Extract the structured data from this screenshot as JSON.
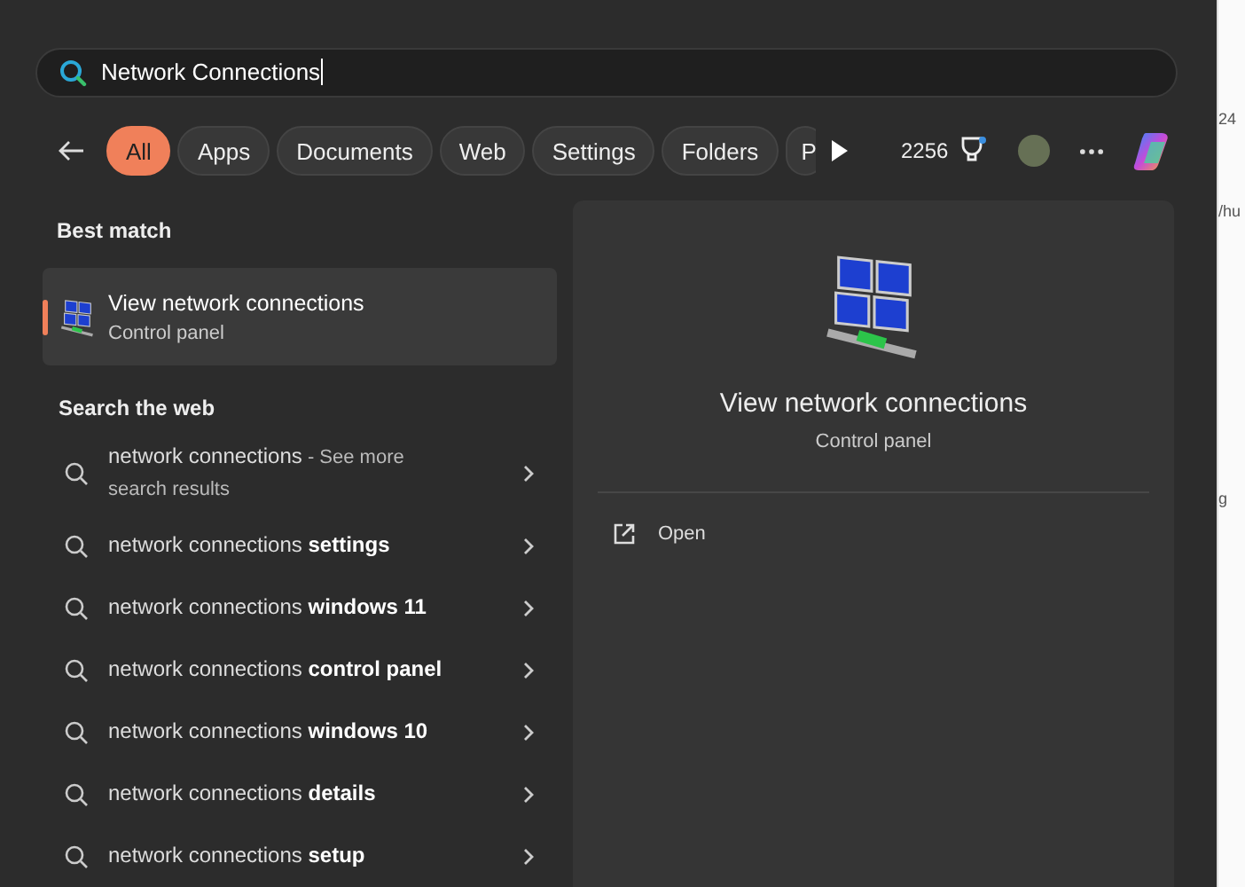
{
  "search": {
    "value": "Network Connections"
  },
  "filters": [
    {
      "label": "All",
      "selected": true
    },
    {
      "label": "Apps",
      "selected": false
    },
    {
      "label": "Documents",
      "selected": false
    },
    {
      "label": "Web",
      "selected": false
    },
    {
      "label": "Settings",
      "selected": false
    },
    {
      "label": "Folders",
      "selected": false
    },
    {
      "label": "P",
      "selected": false
    }
  ],
  "points": "2256",
  "best_match": {
    "heading": "Best match",
    "title": "View network connections",
    "subtitle": "Control panel",
    "selected": true
  },
  "web": {
    "heading": "Search the web",
    "items": [
      {
        "text": "network connections",
        "note": "- See more search results"
      },
      {
        "text": "network connections **settings**"
      },
      {
        "text": "network connections **windows 11**"
      },
      {
        "text": "network connections **control panel**"
      },
      {
        "text": "network connections **windows 10**"
      },
      {
        "text": "network connections **details**"
      },
      {
        "text": "network connections **setup**"
      }
    ]
  },
  "preview": {
    "title": "View network connections",
    "subtitle": "Control panel",
    "actions": [
      {
        "label": "Open"
      }
    ]
  },
  "background_page": [
    "24",
    "/hu",
    "g"
  ]
}
